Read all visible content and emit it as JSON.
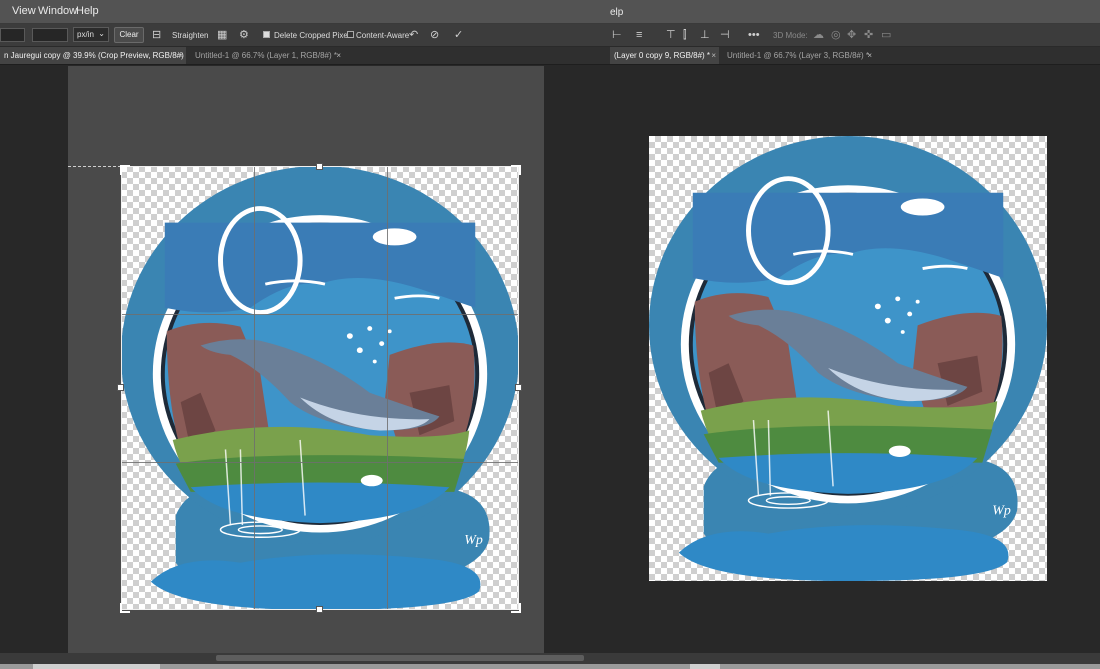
{
  "menu": [
    "View",
    "Window",
    "Help"
  ],
  "menu_fragment_right": "elp",
  "options_bar": {
    "unit_value": "px/in",
    "clear_label": "Clear",
    "straighten_label": "Straighten",
    "delete_cropped_label": "Delete Cropped Pixels",
    "delete_cropped_checked": true,
    "content_aware_label": "Content-Aware",
    "content_aware_checked": false,
    "mode_3d_label": "3D Mode:",
    "icons": [
      "straighten-icon",
      "grid-overlay-icon",
      "settings-gear-icon",
      "reset-icon",
      "cancel-icon",
      "commit-check-icon"
    ]
  },
  "tabs_left": [
    {
      "label": "n Jauregui copy @ 39.9% (Crop Preview, RGB/8#) *",
      "active": true
    },
    {
      "label": "Untitled-1 @ 66.7% (Layer 1, RGB/8#) *",
      "active": false
    }
  ],
  "tabs_right": [
    {
      "label": "(Layer 0 copy 9, RGB/8#) *",
      "active": true
    },
    {
      "label": "Untitled-1 @ 66.7% (Layer 3, RGB/8#) *",
      "active": false
    }
  ],
  "artwork": {
    "signature": "Wp",
    "colors": {
      "ring": "#3a85b2",
      "sky": "#3e94c9",
      "rock": "#8a5b57",
      "grass": "#7aa14c",
      "water": "#2f89c6",
      "whale": "#6a7f98"
    }
  }
}
